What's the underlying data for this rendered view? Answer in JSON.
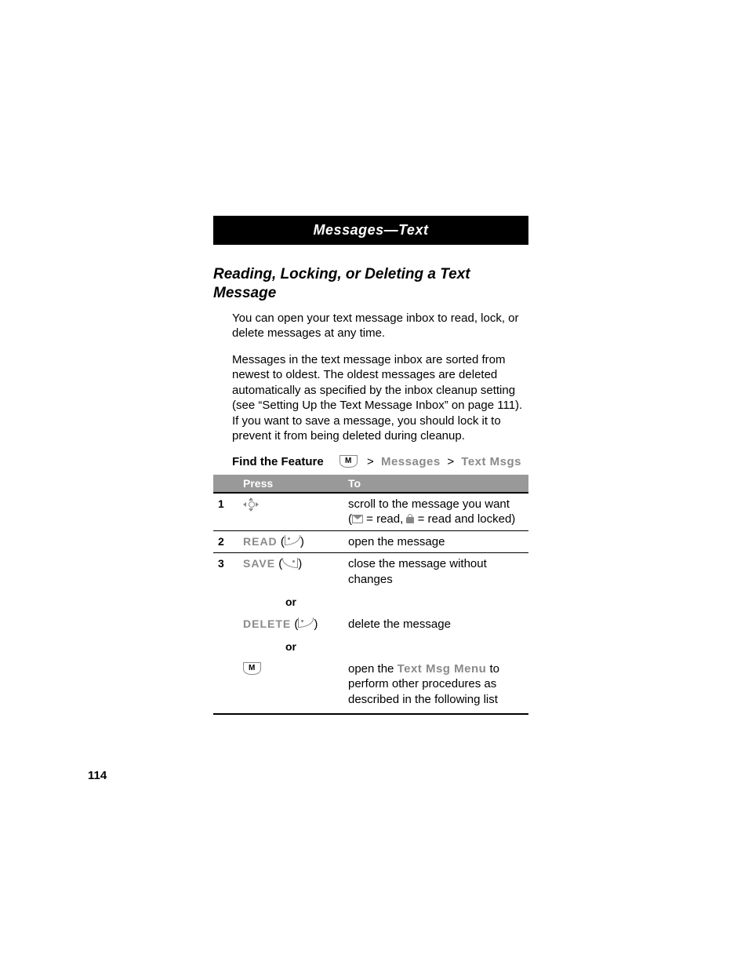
{
  "header": "Messages—Text",
  "section_title": "Reading, Locking, or Deleting a Text Message",
  "paragraphs": {
    "p1": "You can open your text message inbox to read, lock, or delete messages at any time.",
    "p2": "Messages in the text message inbox are sorted from newest to oldest. The oldest messages are deleted automatically as specified by the inbox cleanup setting (see “Setting Up the Text Message Inbox” on page 111). If you want to save a message, you should lock it to prevent it from being deleted during cleanup."
  },
  "find_feature": {
    "label": "Find the Feature",
    "menu_icon_label": "M",
    "path": {
      "item1": "Messages",
      "item2": "Text Msgs",
      "sep": ">"
    }
  },
  "table": {
    "head": {
      "press": "Press",
      "to": "To"
    },
    "rows": {
      "step1": {
        "num": "1",
        "to_a": "scroll to the message you want",
        "to_b_open": "(",
        "to_b_read": " = read, ",
        "to_b_locked": " = read and locked)",
        "nav_aria": "navigate"
      },
      "step2": {
        "num": "2",
        "press": "READ",
        "to": "open the message"
      },
      "step3": {
        "num": "3",
        "press_save": "SAVE",
        "to_save": "close the message without changes",
        "or": "or",
        "press_delete": "DELETE",
        "to_delete": "delete the message",
        "menu_icon_label": "M",
        "to_menu_a": "open the ",
        "to_menu_b": "Text Msg Menu",
        "to_menu_c": " to perform other procedures as described in the following list"
      }
    }
  },
  "page_number": "114"
}
